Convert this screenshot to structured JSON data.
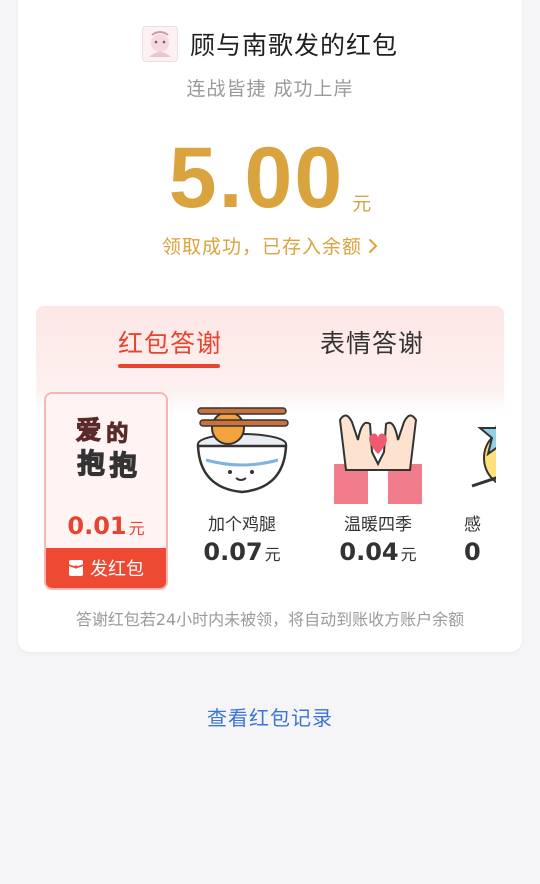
{
  "sender": {
    "name": "顾与南歌发的红包",
    "avatar": "avatar-image"
  },
  "wish": "连战皆捷 成功上岸",
  "amount": {
    "value": "5.00",
    "unit": "元"
  },
  "status": "领取成功，已存入余额",
  "tabs": [
    {
      "label": "红包答谢"
    },
    {
      "label": "表情答谢"
    }
  ],
  "thanks_items": [
    {
      "name": "爱的抱抱",
      "price": "0.01",
      "unit": "元",
      "selected": true,
      "button": "发红包",
      "art_label": "爱的抱抱"
    },
    {
      "name": "加个鸡腿",
      "price": "0.07",
      "unit": "元"
    },
    {
      "name": "温暖四季",
      "price": "0.04",
      "unit": "元"
    },
    {
      "name": "感",
      "price": "0",
      "unit": ""
    }
  ],
  "note": "答谢红包若24小时内未被领，将自动到账收方账户余额",
  "record_link": "查看红包记录",
  "colors": {
    "accent_red": "#e8432e",
    "gold": "#d9a43e",
    "link_blue": "#3b74d9"
  }
}
